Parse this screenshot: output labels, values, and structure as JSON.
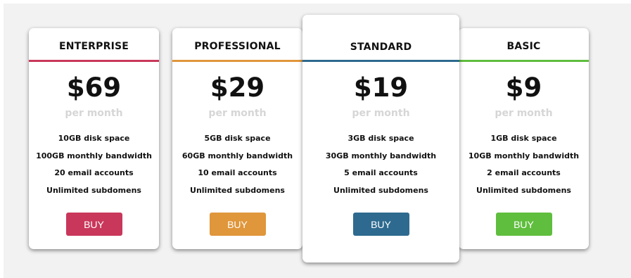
{
  "plans": [
    {
      "name": "ENTERPRISE",
      "price": "$69",
      "period": "per month",
      "features": [
        "10GB disk space",
        "100GB monthly bandwidth",
        "20 email accounts",
        "Unlimited subdomens"
      ],
      "button": "BUY",
      "color": "#c9375a"
    },
    {
      "name": "PROFESSIONAL",
      "price": "$29",
      "period": "per month",
      "features": [
        "5GB disk space",
        "60GB monthly bandwidth",
        "10 email accounts",
        "Unlimited subdomens"
      ],
      "button": "BUY",
      "color": "#e0963a"
    },
    {
      "name": "STANDARD",
      "price": "$19",
      "period": "per month",
      "features": [
        "3GB disk space",
        "30GB monthly bandwidth",
        "5 email accounts",
        "Unlimited subdomens"
      ],
      "button": "BUY",
      "color": "#2e6a8f"
    },
    {
      "name": "BASIC",
      "price": "$9",
      "period": "per month",
      "features": [
        "1GB disk space",
        "10GB monthly bandwidth",
        "2 email accounts",
        "Unlimited subdomens"
      ],
      "button": "BUY",
      "color": "#5fbe3d"
    }
  ]
}
